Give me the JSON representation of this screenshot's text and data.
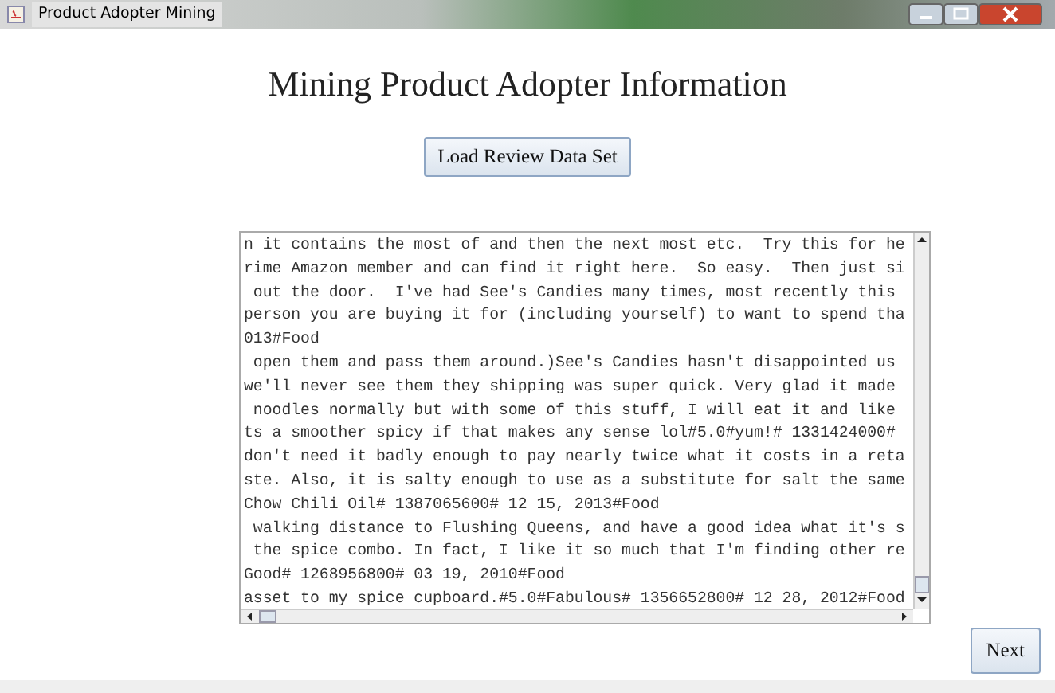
{
  "window": {
    "title": "Product Adopter Mining"
  },
  "heading": "Mining Product Adopter Information",
  "load_button": "Load Review Data Set",
  "text_area": {
    "lines": [
      "n it contains the most of and then the next most etc.  Try this for he",
      "rime Amazon member and can find it right here.  So easy.  Then just si",
      " out the door.  I've had See's Candies many times, most recently this",
      "person you are buying it for (including yourself) to want to spend tha",
      "013#Food",
      " open them and pass them around.)See's Candies hasn't disappointed us",
      "we'll never see them they shipping was super quick. Very glad it made",
      " noodles normally but with some of this stuff, I will eat it and like",
      "ts a smoother spicy if that makes any sense lol#5.0#yum!# 1331424000#",
      "don't need it badly enough to pay nearly twice what it costs in a reta",
      "ste. Also, it is salty enough to use as a substitute for salt the same",
      "Chow Chili Oil# 1387065600# 12 15, 2013#Food",
      " walking distance to Flushing Queens, and have a good idea what it's s",
      " the spice combo. In fact, I like it so much that I'm finding other re",
      "Good# 1268956800# 03 19, 2010#Food",
      "asset to my spice cupboard.#5.0#Fabulous# 1356652800# 12 28, 2012#Food"
    ]
  },
  "next_button": "Next"
}
